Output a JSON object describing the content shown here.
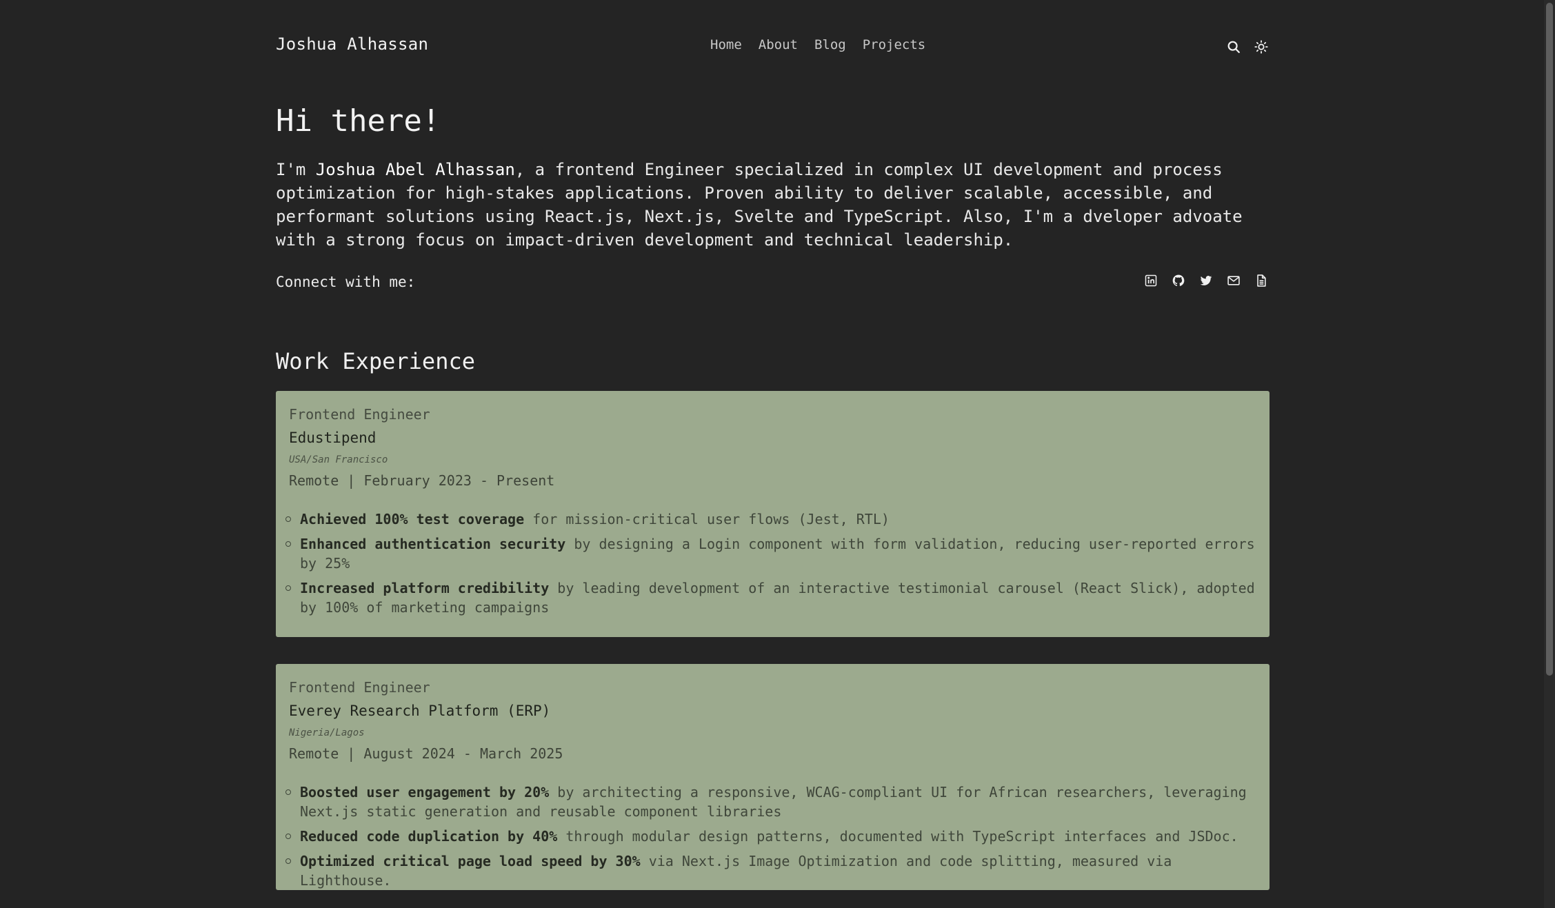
{
  "header": {
    "site_title": "Joshua Alhassan",
    "nav": [
      "Home",
      "About",
      "Blog",
      "Projects"
    ],
    "icons": [
      "search-icon",
      "sun-icon"
    ]
  },
  "hero": {
    "title": "Hi there!",
    "intro_prefix": "I'm ",
    "name": "Joshua Abel Alhassan",
    "intro_rest": ", a frontend Engineer specialized in complex UI development and process optimization for high-stakes applications. Proven ability to deliver scalable, accessible, and performant solutions using React.js, Next.js, Svelte and TypeScript. Also, I'm a dveloper advoate with a strong focus on impact-driven development and technical leadership.",
    "connect_label": "Connect with me:",
    "social_icons": [
      "linkedin-icon",
      "github-icon",
      "twitter-icon",
      "mail-icon",
      "document-icon"
    ]
  },
  "work": {
    "section_title": "Work Experience",
    "jobs": [
      {
        "role": "Frontend Engineer",
        "company": "Edustipend",
        "location": "USA/San Francisco",
        "period": "Remote | February 2023 - Present",
        "achievements": [
          {
            "bold": "Achieved 100% test coverage",
            "text": " for mission-critical user flows (Jest, RTL)"
          },
          {
            "bold": "Enhanced authentication security",
            "text": " by designing a Login component with form validation, reducing user-reported errors by 25%"
          },
          {
            "bold": "Increased platform credibility",
            "text": " by leading development of an interactive testimonial carousel (React Slick), adopted by 100% of marketing campaigns"
          }
        ]
      },
      {
        "role": "Frontend Engineer",
        "company": "Everey Research Platform (ERP)",
        "location": "Nigeria/Lagos",
        "period": "Remote | August 2024 - March 2025",
        "achievements": [
          {
            "bold": "Boosted user engagement by 20%",
            "text": " by architecting a responsive, WCAG-compliant UI for African researchers, leveraging Next.js static generation and reusable component libraries"
          },
          {
            "bold": "Reduced code duplication by 40%",
            "text": " through modular design patterns, documented with TypeScript interfaces and JSDoc."
          },
          {
            "bold": "Optimized critical page load speed by 30%",
            "text": " via Next.js Image Optimization and code splitting, measured via Lighthouse."
          }
        ]
      }
    ]
  }
}
